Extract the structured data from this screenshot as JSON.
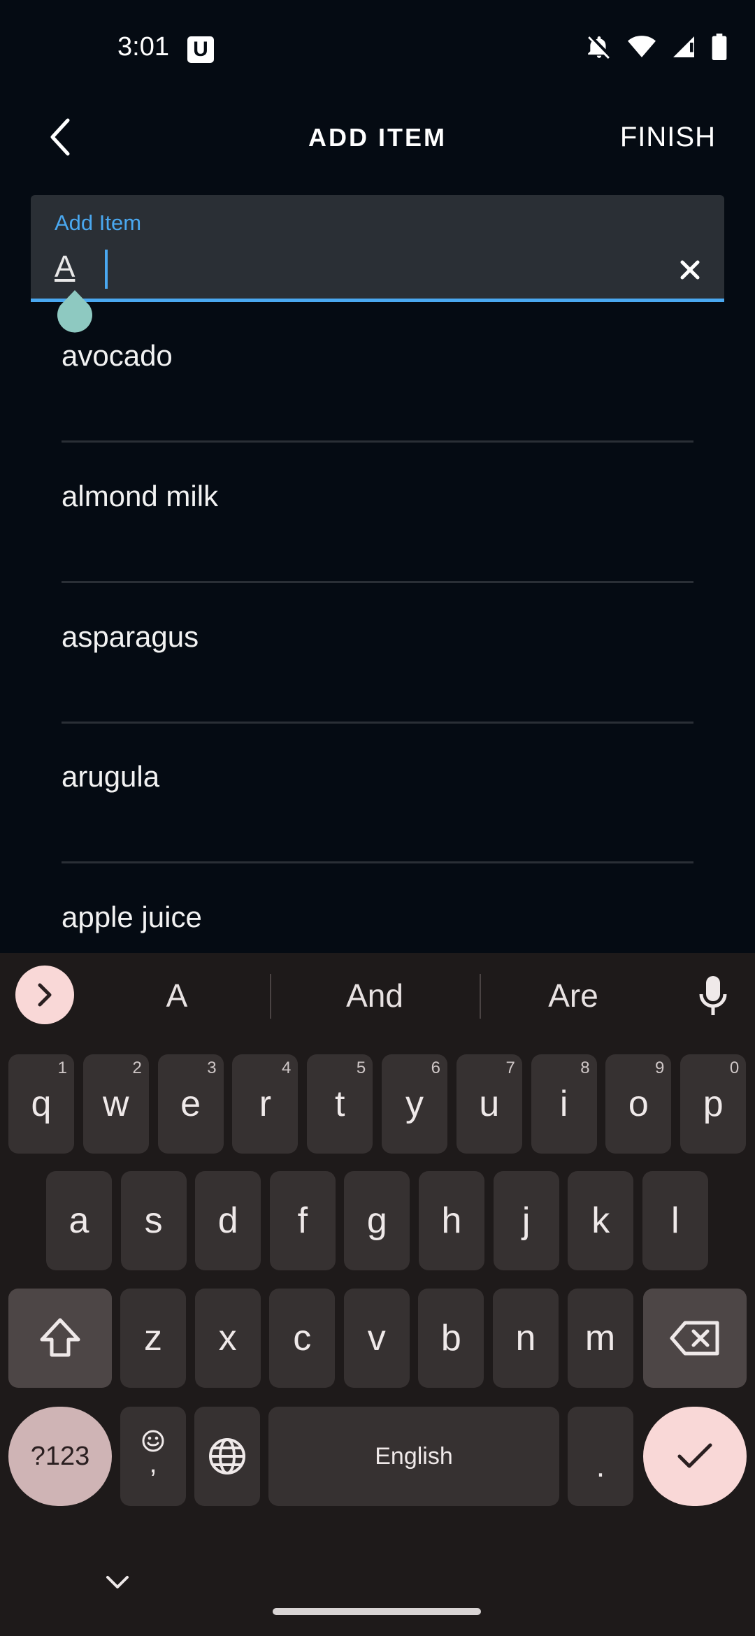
{
  "status": {
    "time": "3:01",
    "badge": "U"
  },
  "header": {
    "title": "ADD ITEM",
    "finish": "FINISH"
  },
  "field": {
    "label": "Add Item",
    "value": "A"
  },
  "suggestions": [
    "avocado",
    "almond milk",
    "asparagus",
    "arugula",
    "apple juice"
  ],
  "keyboard": {
    "suggestions": [
      "A",
      "And",
      "Are"
    ],
    "row1": [
      {
        "k": "q",
        "h": "1"
      },
      {
        "k": "w",
        "h": "2"
      },
      {
        "k": "e",
        "h": "3"
      },
      {
        "k": "r",
        "h": "4"
      },
      {
        "k": "t",
        "h": "5"
      },
      {
        "k": "y",
        "h": "6"
      },
      {
        "k": "u",
        "h": "7"
      },
      {
        "k": "i",
        "h": "8"
      },
      {
        "k": "o",
        "h": "9"
      },
      {
        "k": "p",
        "h": "0"
      }
    ],
    "row2": [
      "a",
      "s",
      "d",
      "f",
      "g",
      "h",
      "j",
      "k",
      "l"
    ],
    "row3": [
      "z",
      "x",
      "c",
      "v",
      "b",
      "n",
      "m"
    ],
    "symbols": "?123",
    "comma": ",",
    "space": "English",
    "period": "."
  },
  "icons": {
    "back": "chevron-left-icon",
    "clear": "close-icon",
    "expand": "chevron-right-icon",
    "mic": "microphone-icon",
    "shift": "shift-icon",
    "backspace": "backspace-icon",
    "emoji": "emoji-icon",
    "globe": "globe-icon",
    "enter": "checkmark-icon",
    "hide": "chevron-down-icon"
  },
  "colors": {
    "accent": "#4aa8f0",
    "background": "#050b13",
    "keyboard": "#1e1a1a",
    "enter": "#f9d8d7"
  }
}
